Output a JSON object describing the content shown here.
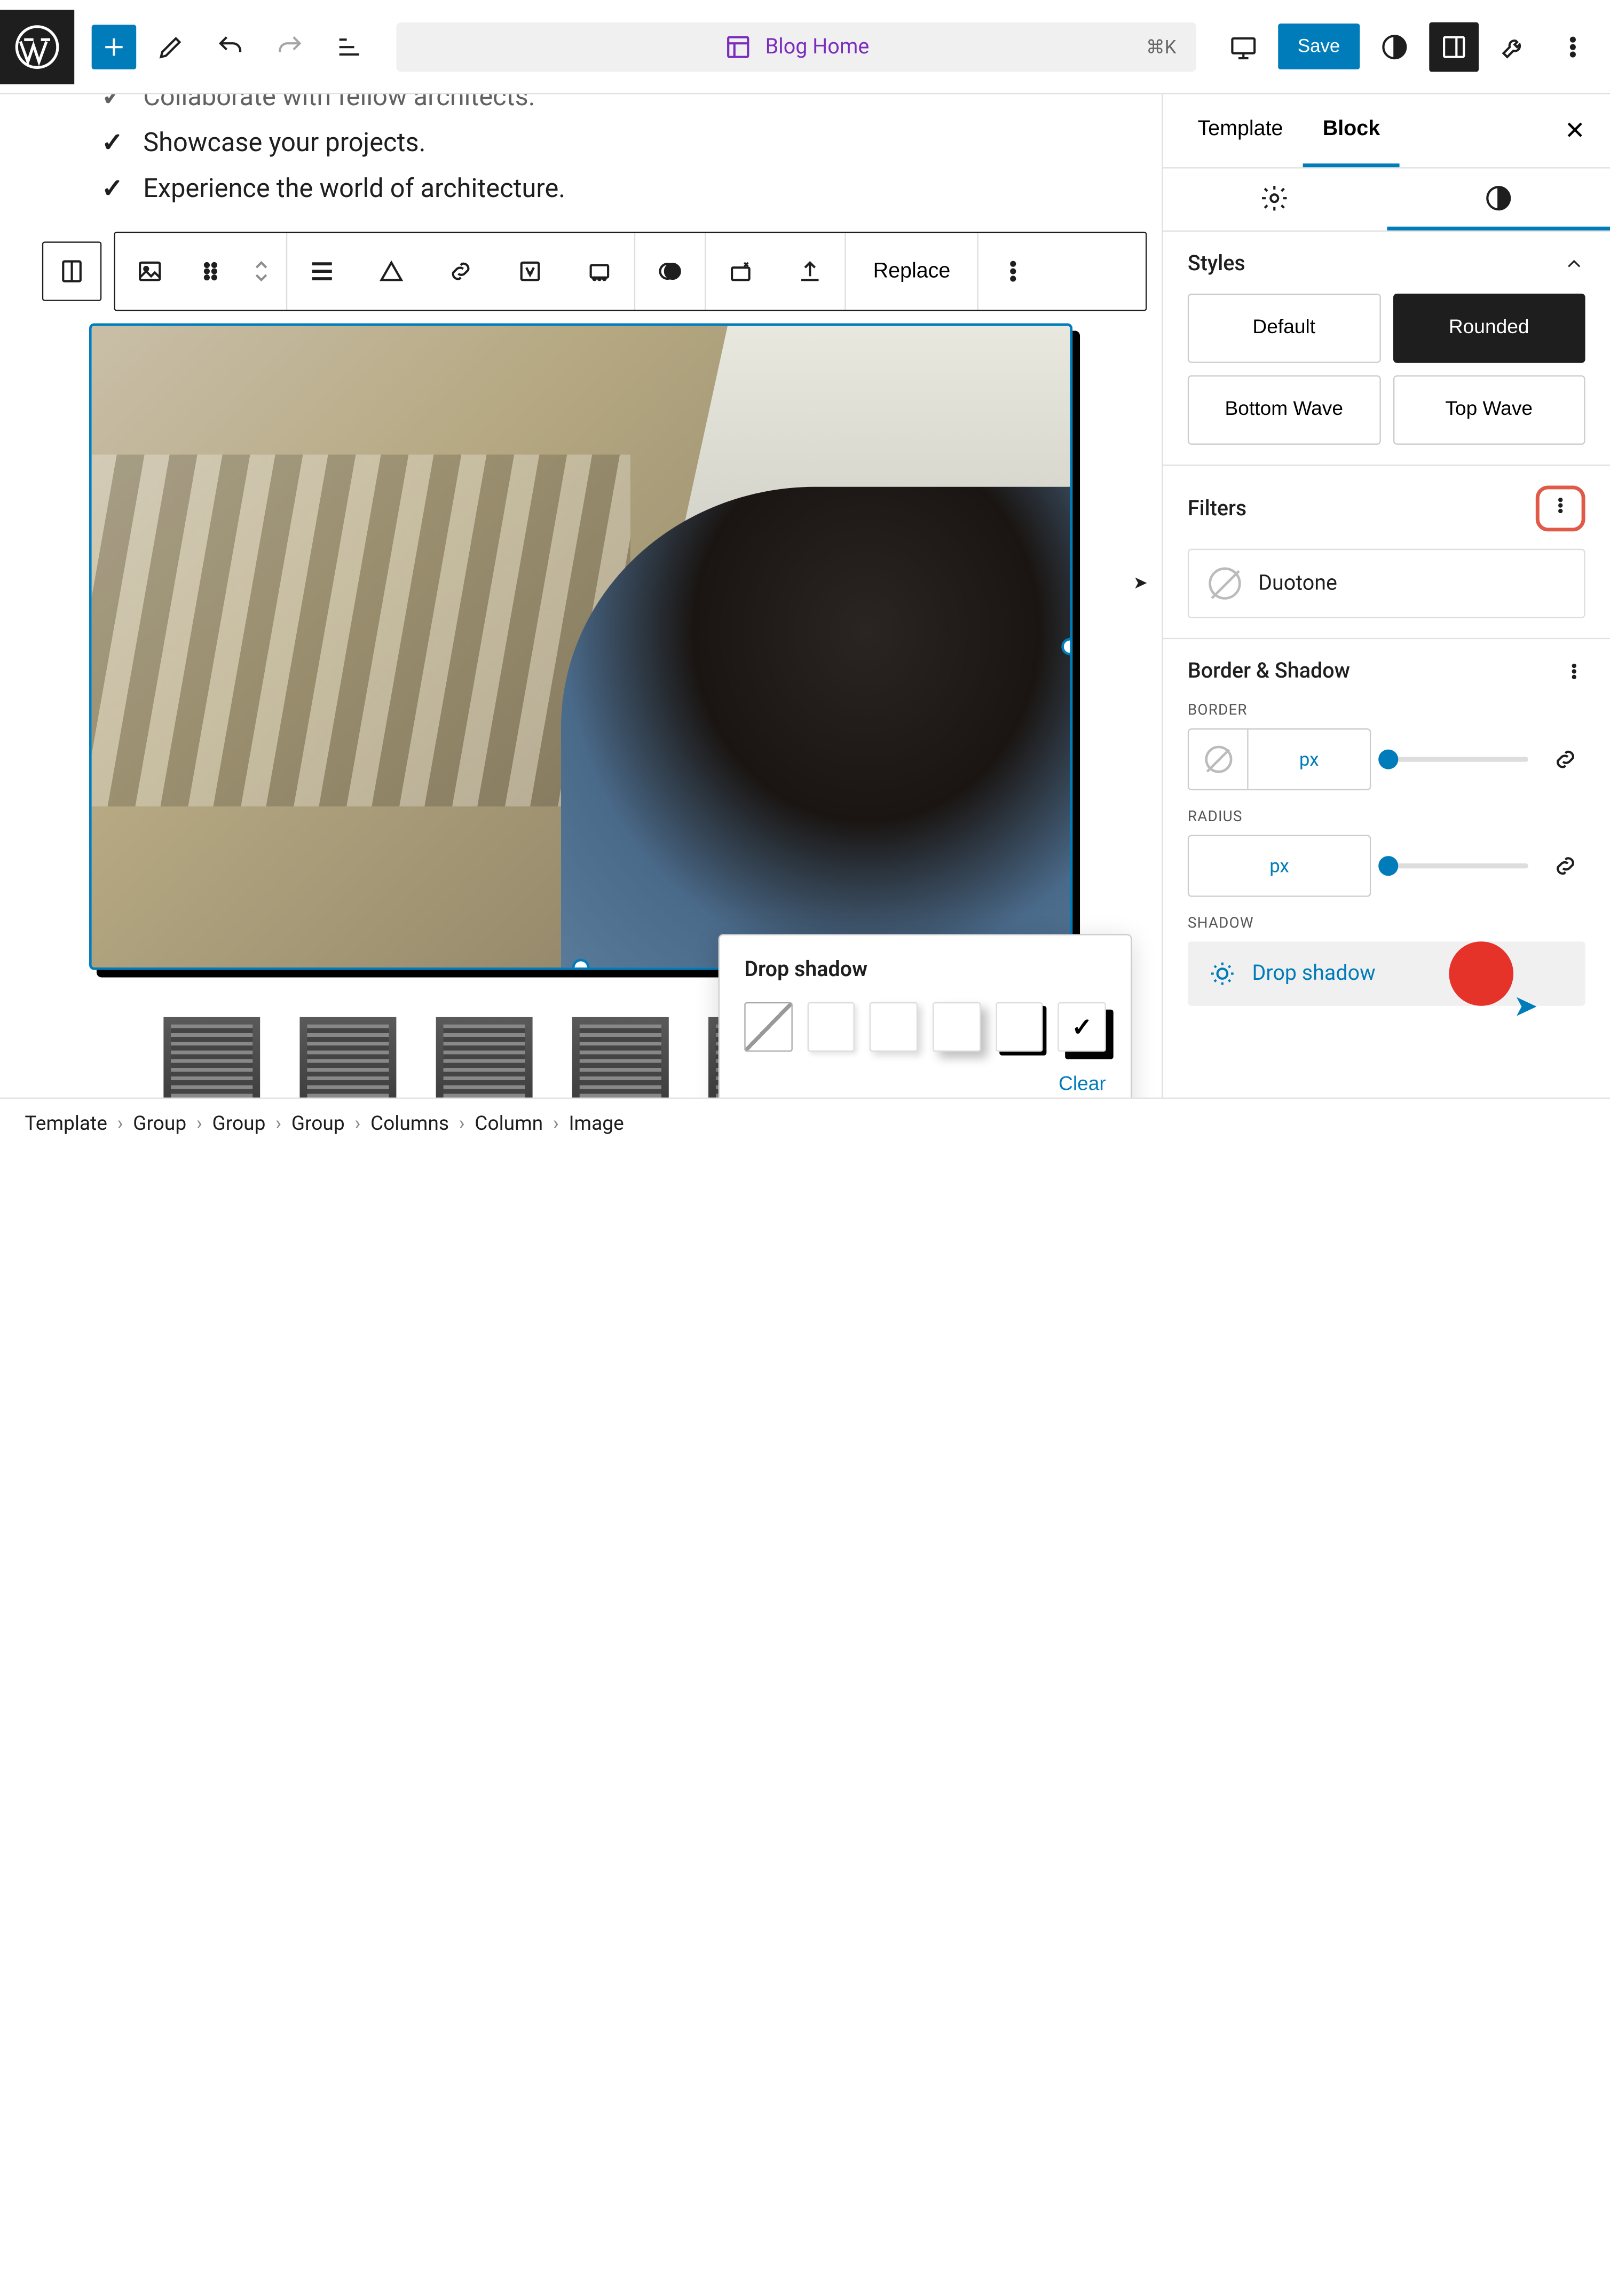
{
  "topbar": {
    "doc_title": "Blog Home",
    "shortcut": "⌘K",
    "save": "Save"
  },
  "list": {
    "item0": "Collaborate with fellow architects.",
    "item1": "Showcase your projects.",
    "item2": "Experience the world of architecture."
  },
  "block_toolbar": {
    "replace": "Replace"
  },
  "popover": {
    "title": "Drop shadow",
    "clear": "Clear"
  },
  "sidebar": {
    "tabs": {
      "template": "Template",
      "block": "Block"
    },
    "styles": {
      "heading": "Styles",
      "default": "Default",
      "rounded": "Rounded",
      "bottom_wave": "Bottom Wave",
      "top_wave": "Top Wave"
    },
    "filters": {
      "heading": "Filters",
      "duotone": "Duotone"
    },
    "border_shadow": {
      "heading": "Border & Shadow",
      "border_label": "BORDER",
      "radius_label": "RADIUS",
      "shadow_label": "SHADOW",
      "unit": "px",
      "drop_shadow": "Drop shadow"
    }
  },
  "breadcrumb": {
    "c0": "Template",
    "c1": "Group",
    "c2": "Group",
    "c3": "Group",
    "c4": "Columns",
    "c5": "Column",
    "c6": "Image"
  }
}
